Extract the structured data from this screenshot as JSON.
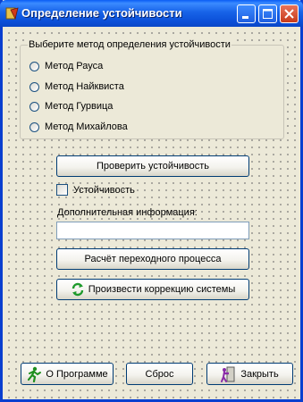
{
  "window": {
    "title": "Определение устойчивости",
    "controls": {
      "minimize_icon": "minimize-icon",
      "maximize_icon": "maximize-icon",
      "close_icon": "close-icon"
    }
  },
  "method_group": {
    "caption": "Выберите метод определения устойчивости",
    "options": [
      {
        "label": "Метод Рауса",
        "selected": false
      },
      {
        "label": "Метод Найквиста",
        "selected": false
      },
      {
        "label": "Метод Гурвица",
        "selected": false
      },
      {
        "label": "Метод Михайлова",
        "selected": false
      }
    ]
  },
  "actions": {
    "check_label": "Проверить устойчивость",
    "stability_checkbox_label": "Устойчивость",
    "stability_checked": false,
    "info_label": "Дополнительная информация:",
    "info_value": "",
    "transient_label": "Расчёт переходного процесса",
    "correction_label": "Произвести коррекцию системы",
    "correction_icon": "refresh-icon"
  },
  "footer": {
    "about_label": "О Программе",
    "about_icon": "running-man-icon",
    "reset_label": "Сброс",
    "close_label": "Закрыть",
    "close_icon": "door-exit-icon"
  },
  "colors": {
    "titlebar": "#0b4fd8",
    "close_button": "#c73a1a",
    "face": "#ece9d8"
  }
}
